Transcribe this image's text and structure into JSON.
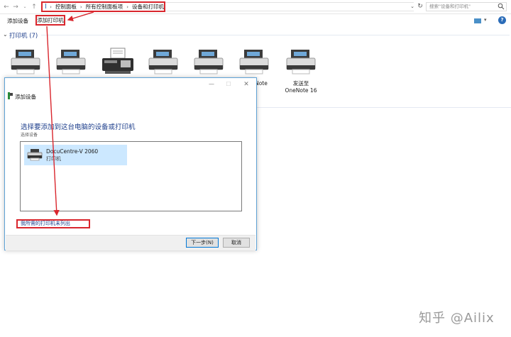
{
  "address_bar": {
    "crumbs": [
      "控制面板",
      "所有控制面板项",
      "设备和打印机"
    ],
    "search_placeholder": "搜索\"设备和打印机\""
  },
  "command_bar": {
    "add_device": "添加设备",
    "add_printer": "添加打印机"
  },
  "group": {
    "title": "打印机 (7)"
  },
  "devices": [
    {
      "kind": "printer",
      "label": ""
    },
    {
      "kind": "printer",
      "label": ""
    },
    {
      "kind": "fax",
      "label": ""
    },
    {
      "kind": "printer",
      "label": ""
    },
    {
      "kind": "printer",
      "label": ""
    },
    {
      "kind": "printer",
      "label": "Note"
    },
    {
      "kind": "printer",
      "label_line1": "发送至",
      "label_line2": "OneNote 16"
    }
  ],
  "dialog": {
    "title": "添加设备",
    "heading": "选择要添加到这台电脑的设备或打印机",
    "subheading": "选择设备",
    "items": [
      {
        "name": "DocuCentre-V 2060",
        "type": "打印机"
      }
    ],
    "not_listed_link": "我所需的打印机未列出",
    "next_button": "下一步(N)",
    "cancel_button": "取消"
  },
  "watermark": "知乎 @Ailix",
  "colors": {
    "highlight_red": "#d9262d",
    "link_blue": "#1e3f8c",
    "selection": "#cce8ff"
  }
}
